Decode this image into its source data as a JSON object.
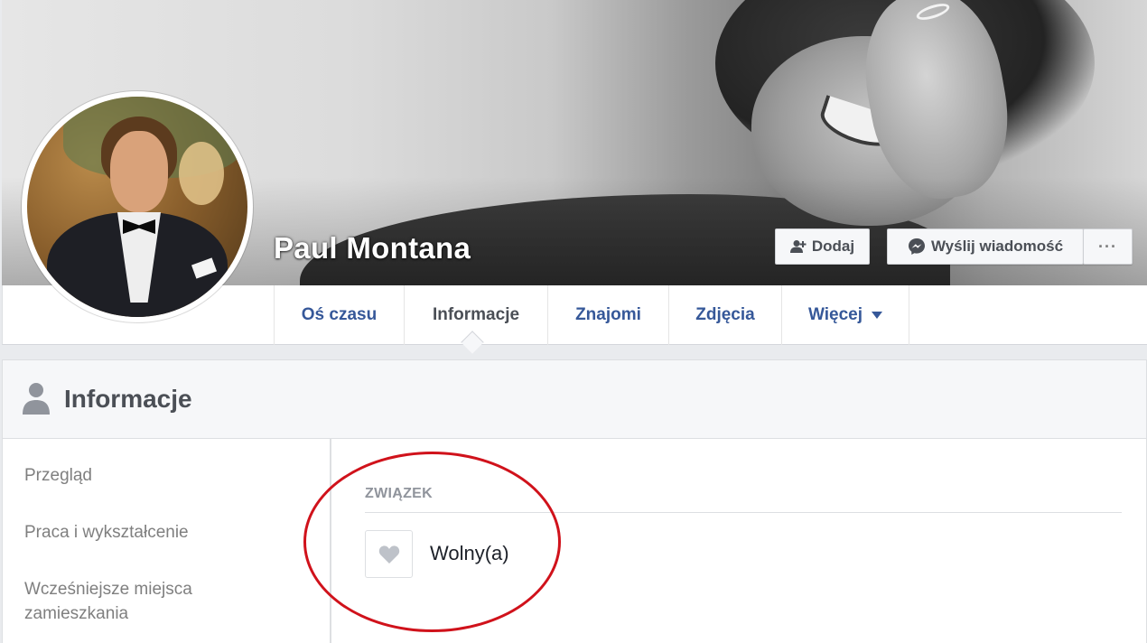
{
  "profile": {
    "name": "Paul Montana"
  },
  "actions": {
    "add_label": "Dodaj",
    "message_label": "Wyślij wiadomość",
    "more_label": "···"
  },
  "nav": {
    "tabs": [
      {
        "label": "Oś czasu"
      },
      {
        "label": "Informacje",
        "active": true
      },
      {
        "label": "Znajomi"
      },
      {
        "label": "Zdjęcia"
      },
      {
        "label": "Więcej"
      }
    ]
  },
  "about": {
    "title": "Informacje",
    "sidebar": [
      {
        "label": "Przegląd"
      },
      {
        "label": "Praca i wykształcenie"
      },
      {
        "label": "Wcześniejsze miejsca zamieszkania"
      }
    ],
    "section_title": "ZWIĄZEK",
    "relationship_status": "Wolny(a)"
  },
  "icons": {
    "add_friend": "add-friend-icon",
    "messenger": "messenger-icon",
    "person": "person-icon",
    "heart": "heart-icon",
    "caret": "caret-down-icon"
  },
  "colors": {
    "link_blue": "#365899",
    "text_dark": "#4b4f56",
    "muted": "#90949c",
    "highlight_red": "#d0121b",
    "page_bg": "#e9ebee"
  }
}
